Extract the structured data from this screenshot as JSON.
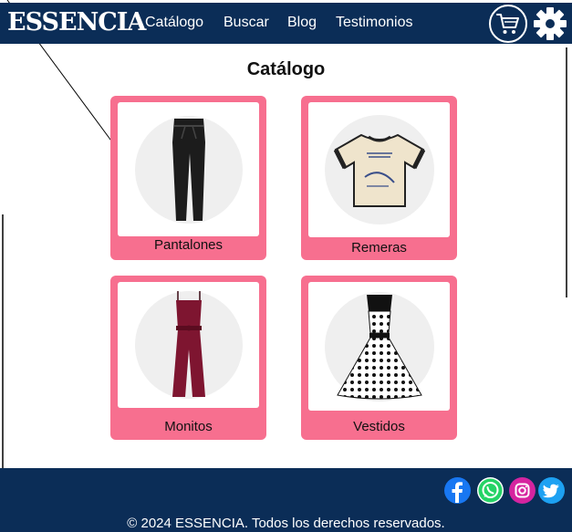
{
  "header": {
    "brand": "ESSENCIA",
    "nav": [
      "Catálogo",
      "Buscar",
      "Blog",
      "Testimonios"
    ],
    "cart_icon": "cart-icon",
    "settings_icon": "gear-icon"
  },
  "main": {
    "title": "Catálogo",
    "categories": [
      {
        "label": "Pantalones",
        "icon": "pants-image"
      },
      {
        "label": "Remeras",
        "icon": "tshirt-image"
      },
      {
        "label": "Monitos",
        "icon": "jumpsuit-image"
      },
      {
        "label": "Vestidos",
        "icon": "dress-image"
      }
    ]
  },
  "footer": {
    "social": [
      "facebook-icon",
      "whatsapp-icon",
      "instagram-icon",
      "twitter-icon"
    ],
    "copyright": "© 2024 ESSENCIA. Todos los derechos reservados."
  },
  "colors": {
    "navy": "#0b2d57",
    "card_pink": "#f76f8f",
    "white": "#ffffff"
  }
}
